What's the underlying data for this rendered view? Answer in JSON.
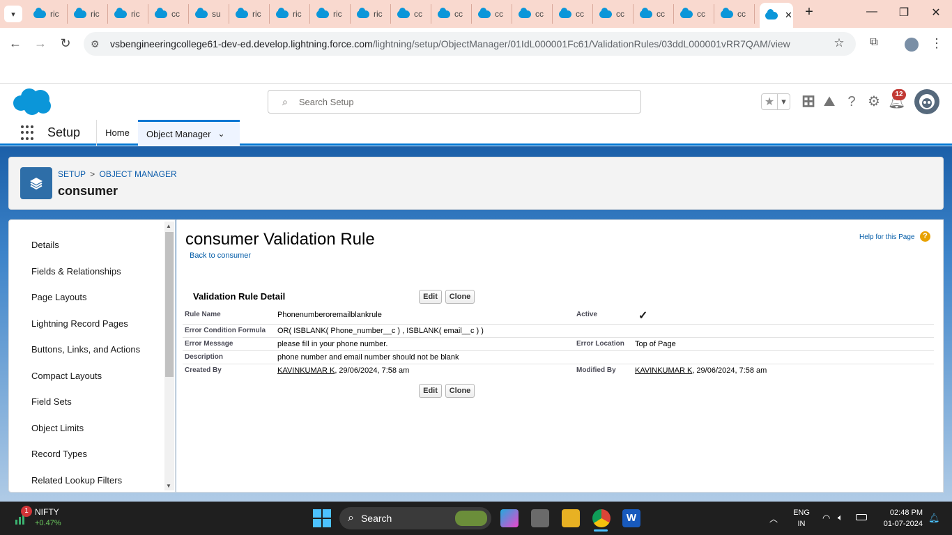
{
  "browser": {
    "tabs": [
      "ric",
      "ric",
      "ric",
      "cc",
      "su",
      "ric",
      "ric",
      "ric",
      "ric",
      "cc",
      "cc",
      "cc",
      "cc",
      "cc",
      "cc",
      "cc",
      "cc",
      "cc"
    ],
    "url_host": "vsbengineeringcollege61-dev-ed.develop.lightning.force.com",
    "url_path": "/lightning/setup/ObjectManager/01IdL000001Fc61/ValidationRules/03ddL000001vRR7QAM/view"
  },
  "header": {
    "search_placeholder": "Search Setup",
    "notification_count": "12"
  },
  "nav": {
    "app_name": "Setup",
    "home": "Home",
    "object_manager": "Object Manager"
  },
  "page_header": {
    "breadcrumb_setup": "SETUP",
    "breadcrumb_sep": ">",
    "breadcrumb_objmgr": "OBJECT MANAGER",
    "object_name": "consumer"
  },
  "sidebar": {
    "items": [
      "Details",
      "Fields & Relationships",
      "Page Layouts",
      "Lightning Record Pages",
      "Buttons, Links, and Actions",
      "Compact Layouts",
      "Field Sets",
      "Object Limits",
      "Record Types",
      "Related Lookup Filters"
    ]
  },
  "main": {
    "title": "consumer Validation Rule",
    "back_link": "Back to consumer",
    "help_link": "Help for this Page",
    "section_title": "Validation Rule Detail",
    "edit": "Edit",
    "clone": "Clone",
    "fields": {
      "rule_name_label": "Rule Name",
      "rule_name": "Phonenumberoremailblankrule",
      "active_label": "Active",
      "active_check": "✓",
      "formula_label": "Error Condition Formula",
      "formula": "OR( ISBLANK( Phone_number__c ) , ISBLANK( email__c ) )",
      "message_label": "Error Message",
      "message": "please fill in your phone number.",
      "location_label": "Error Location",
      "location": "Top of Page",
      "description_label": "Description",
      "description": "phone number and email number should not be blank",
      "created_label": "Created By",
      "created_user": "KAVINKUMAR K",
      "created_date": ", 29/06/2024, 7:58 am",
      "modified_label": "Modified By",
      "modified_user": "KAVINKUMAR K",
      "modified_date": ", 29/06/2024, 7:58 am"
    }
  },
  "taskbar": {
    "stock_name": "NIFTY",
    "stock_change": "+0.47%",
    "stock_badge": "1",
    "search": "Search",
    "lang_top": "ENG",
    "lang_bottom": "IN",
    "time": "02:48 PM",
    "date": "01-07-2024"
  },
  "colors": {
    "brand_blue": "#0176d3",
    "link": "#015ba7",
    "tabstrip": "#f9d9cf"
  }
}
